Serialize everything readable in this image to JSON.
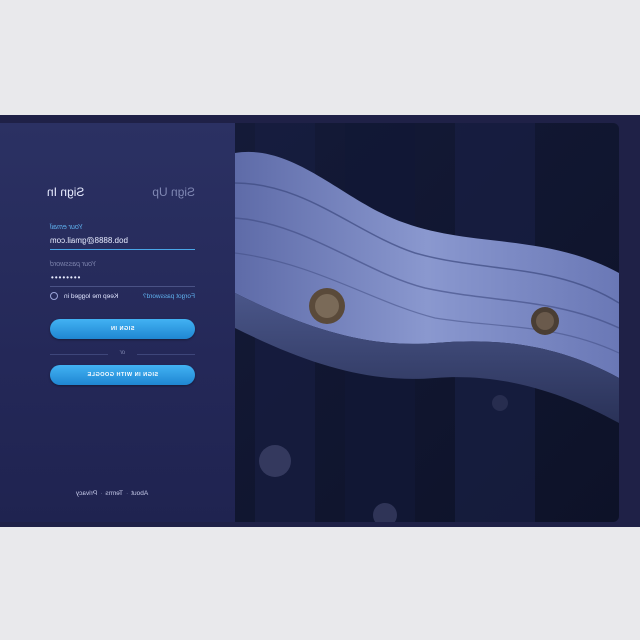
{
  "tabs": {
    "signin": "Sign In",
    "signup": "Sign Up"
  },
  "email": {
    "label": "Your email",
    "value": "bob.8888@gmail.com"
  },
  "password": {
    "label": "Your password",
    "value": "••••••••"
  },
  "options": {
    "keep_logged_in": "Keep me logged in",
    "forgot": "Forgot password?"
  },
  "buttons": {
    "signin": "SIGN IN",
    "google": "SIGN IN WITH GOOGLE"
  },
  "divider": "or",
  "footer": {
    "about": "About",
    "terms": "Terms",
    "privacy": "Privacy"
  },
  "colors": {
    "accent": "#3aa6ee",
    "panel": "#272b5c",
    "background": "#1f2147"
  }
}
